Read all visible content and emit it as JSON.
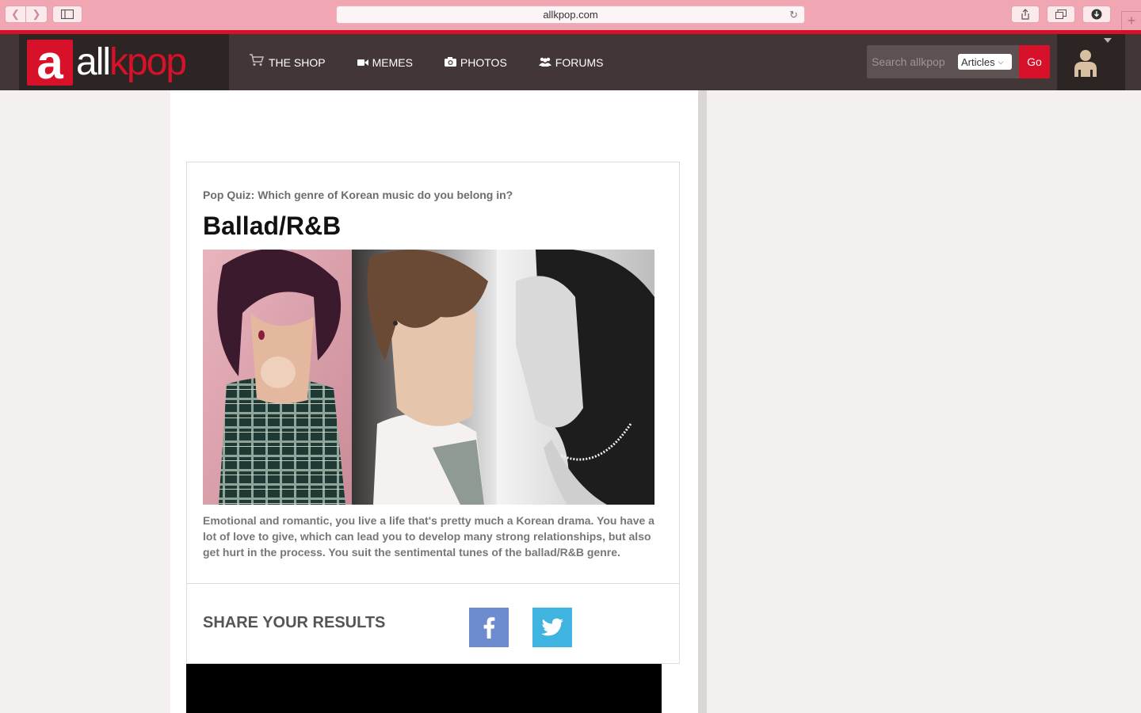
{
  "browser": {
    "url": "allkpop.com",
    "icons": [
      "back-icon",
      "forward-icon",
      "sidebar-icon",
      "reload-icon",
      "share-icon",
      "tabs-icon",
      "download-icon",
      "new-tab-icon"
    ]
  },
  "header": {
    "logo_letter": "a",
    "logo_all": "all",
    "logo_kpop": "kpop",
    "nav": [
      {
        "label": "THE SHOP",
        "icon": "cart-icon"
      },
      {
        "label": "MEMES",
        "icon": "video-camera-icon"
      },
      {
        "label": "PHOTOS",
        "icon": "camera-icon"
      },
      {
        "label": "FORUMS",
        "icon": "users-icon"
      }
    ],
    "search": {
      "placeholder": "Search allkpop",
      "scope": "Articles",
      "go_label": "Go"
    },
    "user_icon": "user-avatar-icon"
  },
  "result": {
    "quiz_title": "Pop Quiz: Which genre of Korean music do you belong in?",
    "title": "Ballad/R&B",
    "description": "Emotional and romantic, you live a life that's pretty much a Korean drama. You have a lot of love to give, which can lead you to develop many strong relationships, but also get hurt in the process. You suit the sentimental tunes of the ballad/R&B genre.",
    "share_label": "SHARE YOUR RESULTS",
    "share_buttons": [
      "facebook-icon",
      "twitter-icon"
    ]
  },
  "colors": {
    "brand_red": "#d8112b",
    "header_bg": "#423636",
    "facebook": "#6d8ccf",
    "twitter": "#3fb4e0"
  }
}
